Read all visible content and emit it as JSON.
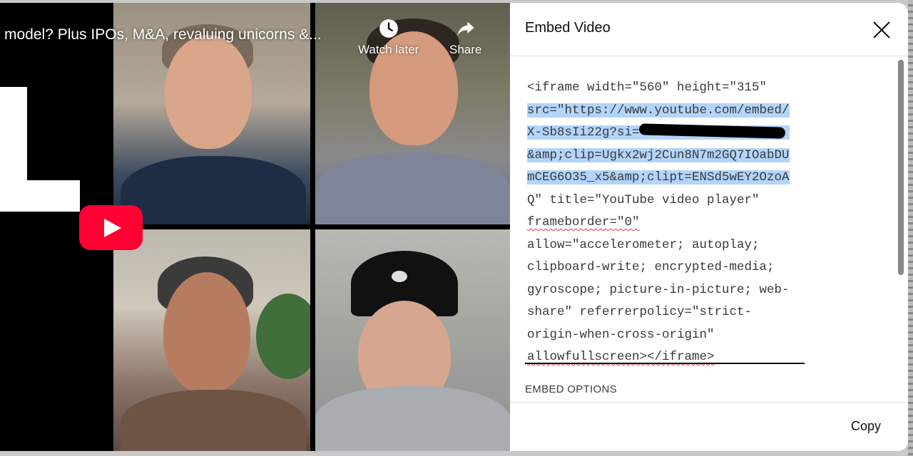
{
  "video": {
    "title": "model? Plus IPOs, M&A, revaluing unicorns &...",
    "watch_later_label": "Watch later",
    "share_label": "Share",
    "play_icon": "youtube-play-icon"
  },
  "dialog": {
    "title": "Embed Video",
    "code_lines": [
      "<iframe width=\"560\" height=\"315\"",
      "src=\"https://www.youtube.com/embed/",
      "X-Sb8sIi22g?si=",
      "&amp;clip=Ugkx2wj2Cun8N7m2GQ7IOabDU",
      "mCEG6O35_x5&amp;clipt=ENSd5wEY2OzoA",
      "Q\" title=\"YouTube video player\"",
      "frameborder=\"0\"",
      "allow=\"accelerometer; autoplay;",
      "clipboard-write; encrypted-media;",
      "gyroscope; picture-in-picture; web-",
      "share\" referrerpolicy=\"strict-",
      "origin-when-cross-origin\"",
      "allowfullscreen></iframe>"
    ],
    "embed_options_label": "EMBED OPTIONS",
    "copy_label": "Copy"
  },
  "colors": {
    "highlight": "#b3d4fb",
    "youtube_red": "#ff0033"
  }
}
